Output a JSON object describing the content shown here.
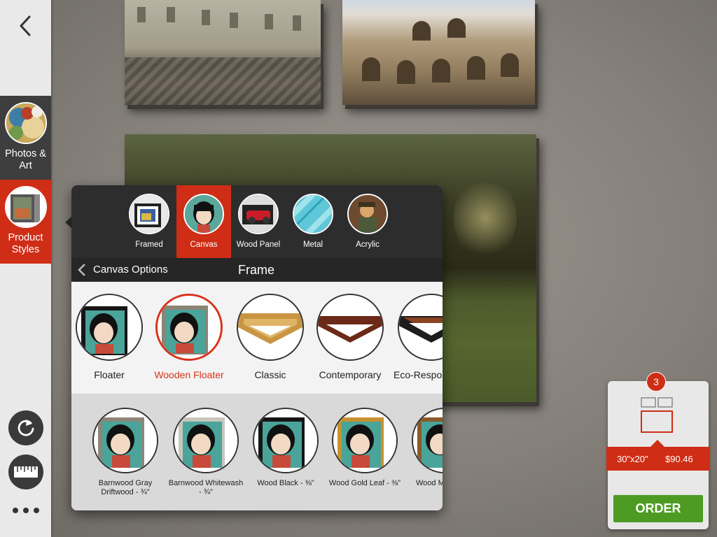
{
  "sidebar": {
    "back_icon": "chevron-left-icon",
    "items": [
      {
        "label_line1": "Photos &",
        "label_line2": "Art",
        "active": false
      },
      {
        "label_line1": "Product",
        "label_line2": "Styles",
        "active": true
      }
    ],
    "refresh_icon": "refresh-icon",
    "measure_icon": "ruler-icon",
    "more_icon": "more-dots-icon"
  },
  "product_types": [
    {
      "label": "Framed",
      "selected": false
    },
    {
      "label": "Canvas",
      "selected": true
    },
    {
      "label": "Wood Panel",
      "selected": false
    },
    {
      "label": "Metal",
      "selected": false
    },
    {
      "label": "Acrylic",
      "selected": false
    }
  ],
  "options_header": {
    "back_label": "Canvas Options",
    "title": "Frame"
  },
  "frame_styles": [
    {
      "label": "Floater",
      "selected": false
    },
    {
      "label": "Wooden Floater",
      "selected": true
    },
    {
      "label": "Classic",
      "selected": false
    },
    {
      "label": "Contemporary",
      "selected": false
    },
    {
      "label": "Eco-Respo",
      "selected": false
    }
  ],
  "frame_finishes": [
    {
      "label_line1": "Barnwood Gray",
      "label_line2": "Driftwood - ¾\""
    },
    {
      "label_line1": "Barnwood Whitewash",
      "label_line2": "- ¾\""
    },
    {
      "label_line1": "Wood Black - ⅜\"",
      "label_line2": ""
    },
    {
      "label_line1": "Wood Gold Leaf - ⅜\"",
      "label_line2": ""
    },
    {
      "label_line1": "Wood M",
      "label_line2": ""
    }
  ],
  "cart": {
    "count": "3",
    "size": "30\"x20\"",
    "price": "$90.46",
    "order_label": "ORDER"
  },
  "colors": {
    "accent": "#cf2d16",
    "order_green": "#4d9b23",
    "dark_panel": "#2d2d2d"
  }
}
